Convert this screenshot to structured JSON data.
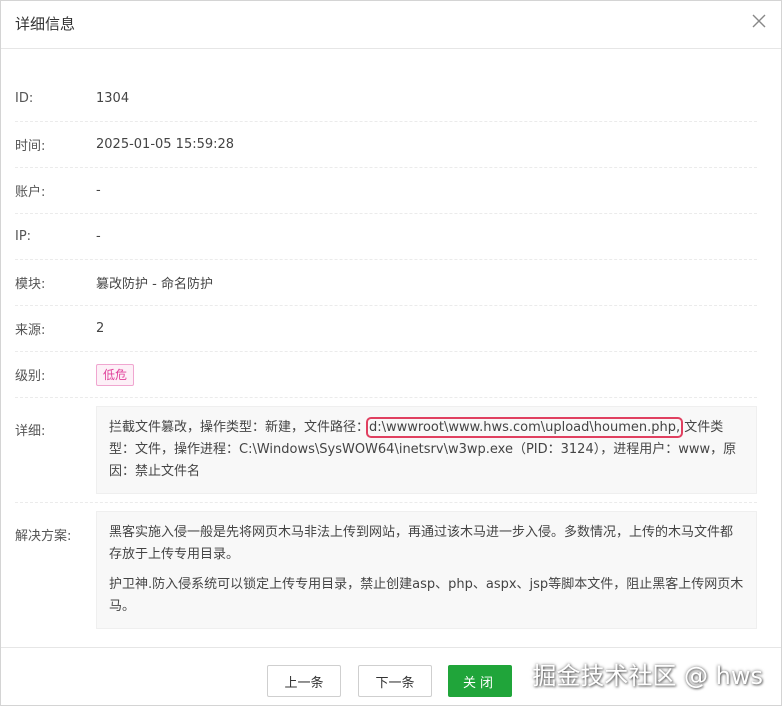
{
  "dialog": {
    "title": "详细信息"
  },
  "fields": {
    "id": {
      "label": "ID:",
      "value": "1304"
    },
    "time": {
      "label": "时间:",
      "value": "2025-01-05 15:59:28"
    },
    "account": {
      "label": "账户:",
      "value": "-"
    },
    "ip": {
      "label": "IP:",
      "value": "-"
    },
    "module": {
      "label": "模块:",
      "value": "篡改防护 - 命名防护"
    },
    "source": {
      "label": "来源:",
      "value": "2"
    },
    "level": {
      "label": "级别:",
      "value": "低危"
    },
    "detail": {
      "label": "详细:",
      "prefix": "拦截文件篡改，操作类型：新建，文件路径：",
      "highlight_path": "d:\\wwwroot\\www.hws.com\\upload\\houmen.php,",
      "suffix": " 文件类型：文件，操作进程：C:\\Windows\\SysWOW64\\inetsrv\\w3wp.exe（PID：3124），进程用户：www，原因：禁止文件名"
    },
    "solution": {
      "label": "解决方案:",
      "paragraphs": [
        "黑客实施入侵一般是先将网页木马非法上传到网站，再通过该木马进一步入侵。多数情况，上传的木马文件都存放于上传专用目录。",
        "护卫神.防入侵系统可以锁定上传专用目录，禁止创建asp、php、aspx、jsp等脚本文件，阻止黑客上传网页木马。"
      ]
    }
  },
  "footer": {
    "prev_label": "上一条",
    "next_label": "下一条",
    "close_label": "关闭"
  },
  "watermark": "掘金技术社区 @ hws",
  "colors": {
    "primary_green": "#20a53a",
    "danger_pink": "#e0409a",
    "highlight_red": "#e04060"
  }
}
